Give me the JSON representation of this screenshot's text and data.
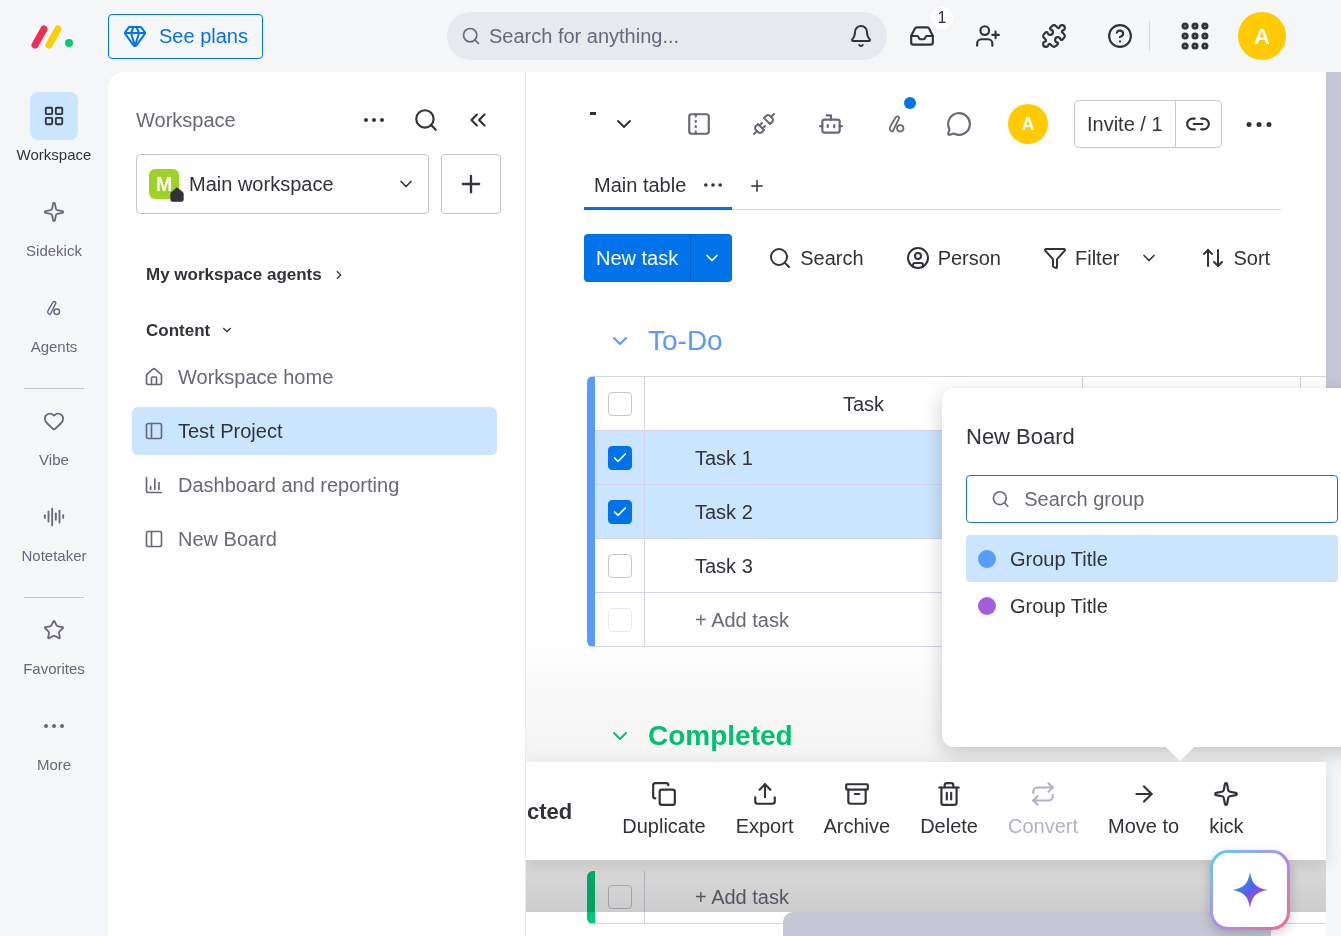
{
  "top_bar": {
    "plans_button": "See plans",
    "search": {
      "placeholder": "Search for anything..."
    },
    "inbox_badge": "1",
    "avatar": "A"
  },
  "rail_sections": [
    {
      "items": [
        {
          "label": "Workspace",
          "kind": "workspace",
          "selected": true
        },
        {
          "label": "Sidekick",
          "kind": "sidekick",
          "selected": false
        },
        {
          "label": "Agents",
          "kind": "agents",
          "selected": false
        }
      ]
    },
    {
      "items": [
        {
          "label": "Vibe",
          "kind": "vibe",
          "selected": false
        },
        {
          "label": "Notetaker",
          "kind": "notetaker",
          "selected": false
        }
      ]
    },
    {
      "items": [
        {
          "label": "Favorites",
          "kind": "favorites",
          "selected": false
        },
        {
          "label": "More",
          "kind": "more",
          "selected": false
        }
      ]
    }
  ],
  "workspace_panel": {
    "title": "Workspace",
    "switcher": {
      "initial": "M",
      "label": "Main workspace"
    },
    "agents_link": "My workspace agents",
    "section": "Content",
    "items": [
      {
        "label": "Workspace home",
        "kind": "home",
        "selected": false
      },
      {
        "label": "Test Project",
        "kind": "board",
        "selected": true
      },
      {
        "label": "Dashboard and reporting",
        "kind": "dashboard",
        "selected": false
      },
      {
        "label": "New Board",
        "kind": "board",
        "selected": false
      }
    ]
  },
  "board": {
    "header": {
      "avatar": "A",
      "invite": "Invite / 1",
      "notification_dot": true
    },
    "views": [
      {
        "label": "Main table",
        "selected": true
      }
    ],
    "new_task": "New task",
    "tools": [
      {
        "label": "Search",
        "kind": "search"
      },
      {
        "label": "Person",
        "kind": "person"
      },
      {
        "label": "Filter",
        "kind": "filter"
      },
      {
        "label": "Sort",
        "kind": "sort"
      }
    ],
    "groups": [
      {
        "title": "To-Do",
        "color": "#579bfc",
        "column": "Task",
        "select_all_checked": false,
        "rows": [
          {
            "task": "Task 1",
            "checked": true
          },
          {
            "task": "Task 2",
            "checked": true
          },
          {
            "task": "Task 3",
            "checked": false
          }
        ],
        "add_row": "+ Add task"
      },
      {
        "title": "Completed",
        "color": "#00c875",
        "add_row": "+ Add task"
      }
    ]
  },
  "action_bar": {
    "selected_text": "cted",
    "actions": [
      {
        "label": "Duplicate",
        "kind": "duplicate",
        "disabled": false
      },
      {
        "label": "Export",
        "kind": "export",
        "disabled": false
      },
      {
        "label": "Archive",
        "kind": "archive",
        "disabled": false
      },
      {
        "label": "Delete",
        "kind": "delete",
        "disabled": false
      },
      {
        "label": "Convert",
        "kind": "convert",
        "disabled": true
      },
      {
        "label": "Move to",
        "kind": "move",
        "disabled": false
      },
      {
        "label": "kick",
        "kind": "sidekick",
        "disabled": false
      }
    ]
  },
  "move_popup": {
    "title": "New Board",
    "search": {
      "placeholder": "Search group"
    },
    "groups": [
      {
        "label": "Group Title",
        "color": "#579bfc",
        "selected": true
      },
      {
        "label": "Group Title",
        "color": "#a25ddc",
        "selected": false
      }
    ]
  }
}
